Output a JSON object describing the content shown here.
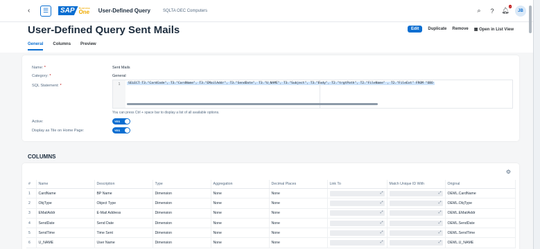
{
  "topbar": {
    "logo_sap": "SAP",
    "logo_one": "One",
    "logo_business": "Business",
    "app_title": "User-Defined Query",
    "company": "SQLTA OEC Computers",
    "notification_count": "2",
    "avatar_initials": "JB"
  },
  "header": {
    "title": "User-Defined Query Sent Mails",
    "actions": {
      "edit": "Edit",
      "duplicate": "Duplicate",
      "remove": "Remove",
      "open_list": "Open in List View"
    },
    "tabs": [
      "General",
      "Columns",
      "Preview"
    ]
  },
  "general": {
    "name_label": "Name:",
    "name_value": "Sent Mails",
    "category_label": "Category:",
    "category_value": "General",
    "sql_label": "SQL Statement:",
    "sql_line_number": "1",
    "sql_text": "SELECT T3.\"CardCode\", T3.\"CardName\", T3.\"EMailAddr\", T3.\"SendDate\", T3.\"U_NAME\", T3.\"Subject\", T3.\"Body\", T2.\"trgtPath\", T2.\"FileName\" , T2.\"FileExt\" FROM \"OBO",
    "sql_hint": "You can press Ctrl + space bar to display a list of all available options.",
    "active_label": "Active:",
    "active_value": "YES",
    "tile_label": "Display as Tile on Home Page:",
    "tile_value": "YES",
    "required_mark": "*"
  },
  "columns": {
    "section_title": "COLUMNS",
    "headers": [
      "#",
      "Name",
      "Description",
      "Type",
      "Aggregation",
      "Decimal Places",
      "Link To",
      "Match Unique ID With",
      "Original"
    ],
    "rows": [
      [
        "1",
        "CardName",
        "BP Name",
        "Dimension",
        "None",
        "None",
        "OEML.CardName"
      ],
      [
        "2",
        "ObjType",
        "Object Type",
        "Dimension",
        "None",
        "None",
        "OEML.ObjType"
      ],
      [
        "3",
        "EMailAddr",
        "E-Mail Address",
        "Dimension",
        "None",
        "None",
        "OEML.EMailAddr"
      ],
      [
        "4",
        "SendDate",
        "Send Date",
        "Dimension",
        "None",
        "None",
        "OEML.SendDate"
      ],
      [
        "5",
        "SendTime",
        "Time Sent",
        "Dimension",
        "None",
        "None",
        "OEML.SendTime"
      ],
      [
        "6",
        "U_NAME",
        "User Name",
        "Dimension",
        "None",
        "None",
        "OEML.U_NAME"
      ]
    ]
  },
  "colors": {
    "accent": "#0a6ed1",
    "brand_one": "#f0ab00"
  }
}
